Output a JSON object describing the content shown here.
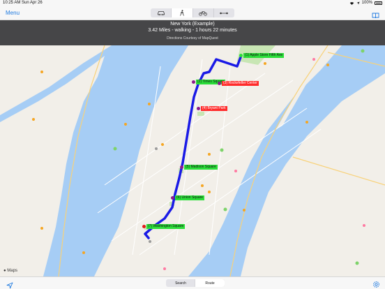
{
  "status": {
    "time": "10:25 AM",
    "date": "Sun Apr 26",
    "battery": "100%"
  },
  "nav": {
    "menu_label": "Menu"
  },
  "modes": [
    {
      "name": "car-icon",
      "active": false
    },
    {
      "name": "walk-icon",
      "active": true
    },
    {
      "name": "bike-icon",
      "active": false
    },
    {
      "name": "route-line-icon",
      "active": false
    }
  ],
  "directions": {
    "title": "New York (Example)",
    "summary": "3.42 Miles - walking - 1 hours 22 minutes",
    "credit": "Directions Courtesy of MapQuest"
  },
  "stops": [
    {
      "label": "(1) Apple Store Fifth Ave",
      "color": "green"
    },
    {
      "label": "(2) Times Square",
      "color": "green"
    },
    {
      "label": "(3) Rockefeller Center",
      "color": "red"
    },
    {
      "label": "(4) Bryant Park",
      "color": "red"
    },
    {
      "label": "(5) Madison Square",
      "color": "green"
    },
    {
      "label": "(6) Union Square",
      "color": "green"
    },
    {
      "label": "(7) Washington Square",
      "color": "green"
    }
  ],
  "map": {
    "attribution": "Maps",
    "route_color": "#1a1ae6",
    "water_color": "#a6cdf5",
    "park_color": "#c8e6b4"
  },
  "tabs": {
    "search": "Search",
    "route": "Route",
    "active": "route"
  }
}
